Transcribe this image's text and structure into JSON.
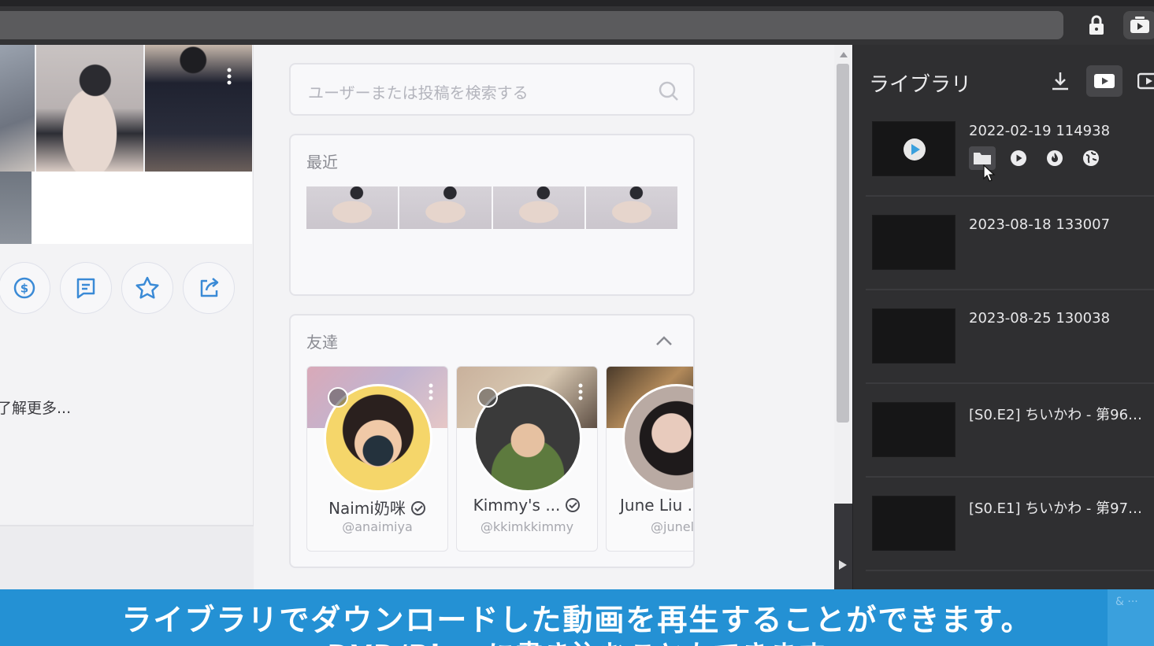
{
  "search": {
    "placeholder": "ユーザーまたは投稿を検索する"
  },
  "recent": {
    "title": "最近"
  },
  "friends": {
    "title": "友達",
    "items": [
      {
        "name": "Naimi奶咪",
        "handle": "@anaimiya",
        "verified": true
      },
      {
        "name": "Kimmy's ...",
        "handle": "@kkimkkimmy",
        "verified": true
      },
      {
        "name": "June Liu .",
        "handle": "@juneli",
        "verified": false
      }
    ]
  },
  "profile": {
    "learn_more": "了解更多..."
  },
  "library": {
    "title": "ライブラリ",
    "items": [
      {
        "title": "2022-02-19 114938"
      },
      {
        "title": "2023-08-18 133007"
      },
      {
        "title": "2023-08-25 130038"
      },
      {
        "title": "[S0.E2] ちいかわ - 第96…"
      },
      {
        "title": "[S0.E1] ちいかわ - 第97…"
      }
    ]
  },
  "caption": {
    "line1": "ライブラリでダウンロードした動画を再生することができます。",
    "line2": "DVD/Bl... に書き込むこともできます",
    "corner": "& ···"
  },
  "colors": {
    "accent": "#2491d4",
    "icon_blue": "#3a8ad6",
    "library_bg": "#2f2f31"
  }
}
